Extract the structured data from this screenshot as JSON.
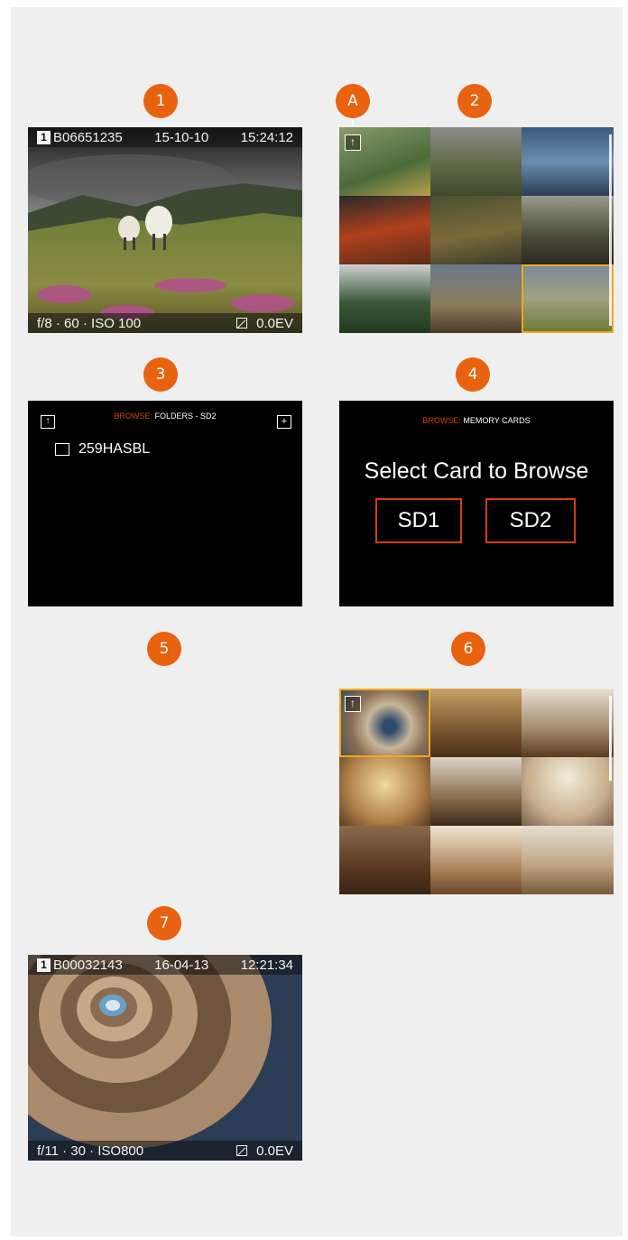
{
  "badges": [
    "1",
    "2",
    "A",
    "3",
    "4",
    "5",
    "6",
    "7"
  ],
  "screen1": {
    "slot": "1",
    "image_id": "B06651235",
    "date": "15-10-10",
    "time": "15:24:12",
    "exposure": "f/8 · 60 · ISO 100",
    "ev": "0.0EV"
  },
  "screen3": {
    "browse_label": "BROWSE:",
    "location": "FOLDERS - SD2",
    "folder_name": "259HASBL"
  },
  "screen4": {
    "browse_label": "BROWSE:",
    "location": "MEMORY CARDS",
    "heading": "Select Card to Browse",
    "card1": "SD1",
    "card2": "SD2"
  },
  "screen7": {
    "slot": "1",
    "image_id": "B00032143",
    "date": "16-04-13",
    "time": "12:21:34",
    "exposure": "f/11 · 30 · ISO800",
    "ev": "0.0EV"
  },
  "colors": {
    "badge": "#e8620f",
    "selection_yellow": "#f0a81c",
    "card_border": "#d4400e",
    "browse_orange": "#d4400e"
  }
}
